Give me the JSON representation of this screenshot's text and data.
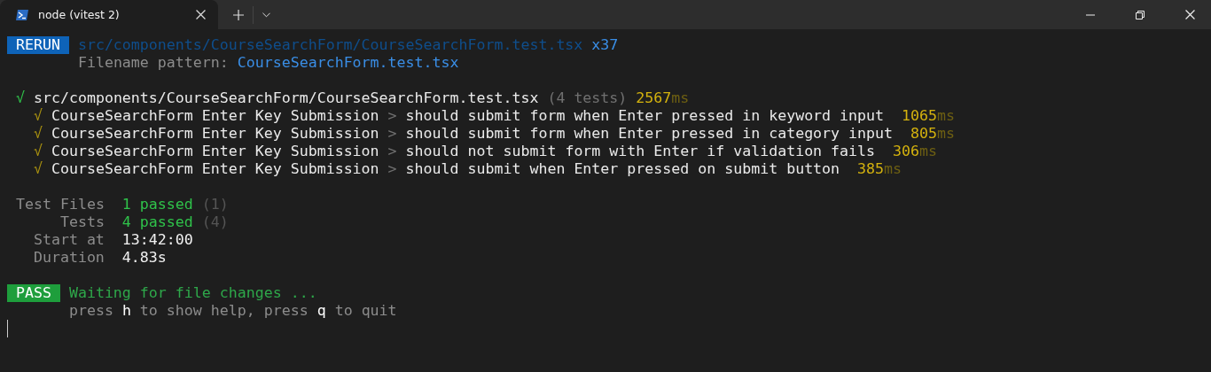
{
  "tab": {
    "title": "node (vitest 2)",
    "selected": true
  },
  "header": {
    "badge": {
      "text": "RERUN",
      "kind": "rerun"
    },
    "path": "src/components/CourseSearchForm/CourseSearchForm.test.tsx",
    "count": "x37",
    "pattern_label": "Filename pattern:",
    "pattern": "CourseSearchForm.test.tsx"
  },
  "suite": {
    "passed": true,
    "mark": "√",
    "file": "src/components/CourseSearchForm/CourseSearchForm.test.tsx",
    "count": "(4 tests)",
    "duration": "2567",
    "unit": "ms",
    "tests": [
      {
        "slow": true,
        "mark": "√",
        "group": "CourseSearchForm Enter Key Submission",
        "separator": ">",
        "title": "should submit form when Enter pressed in keyword input",
        "duration": "1065",
        "unit": "ms"
      },
      {
        "slow": true,
        "mark": "√",
        "group": "CourseSearchForm Enter Key Submission",
        "separator": ">",
        "title": "should submit form when Enter pressed in category input",
        "duration": "805",
        "unit": "ms"
      },
      {
        "slow": true,
        "mark": "√",
        "group": "CourseSearchForm Enter Key Submission",
        "separator": ">",
        "title": "should not submit form with Enter if validation fails",
        "duration": "306",
        "unit": "ms"
      },
      {
        "slow": true,
        "mark": "√",
        "group": "CourseSearchForm Enter Key Submission",
        "separator": ">",
        "title": "should submit when Enter pressed on submit button",
        "duration": "385",
        "unit": "ms"
      }
    ]
  },
  "summary": [
    {
      "label": "Test Files",
      "value": "1 passed",
      "total": "(1)",
      "kind": "count"
    },
    {
      "label": "Tests",
      "value": "4 passed",
      "total": "(4)",
      "kind": "count"
    },
    {
      "label": "Start at",
      "value": "13:42:00",
      "kind": "plain"
    },
    {
      "label": "Duration",
      "value": "4.83s",
      "kind": "plain"
    }
  ],
  "status": {
    "badge": {
      "text": "PASS",
      "kind": "pass"
    },
    "message": "Waiting for file changes ...",
    "hint": [
      {
        "text": "press ",
        "key": false
      },
      {
        "text": "h",
        "key": true
      },
      {
        "text": " to show help, press ",
        "key": false
      },
      {
        "text": "q",
        "key": true
      },
      {
        "text": " to quit",
        "key": false
      }
    ]
  }
}
